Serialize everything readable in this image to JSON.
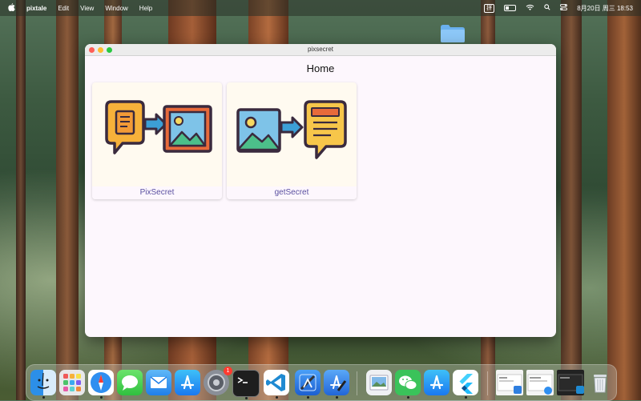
{
  "menubar": {
    "apple_icon": "apple-logo",
    "app_name": "pixtale",
    "menus": [
      "Edit",
      "View",
      "Window",
      "Help"
    ],
    "input_method": "拼",
    "datetime": "8月20日 周三  18:53"
  },
  "window": {
    "title": "pixsecret",
    "page_title": "Home",
    "cards": [
      {
        "label": "PixSecret",
        "icon": "text-to-image-icon"
      },
      {
        "label": "getSecret",
        "icon": "image-to-text-icon"
      }
    ]
  },
  "dock": {
    "apps": [
      {
        "name": "Finder",
        "icon": "finder-icon",
        "running": true
      },
      {
        "name": "Launchpad",
        "icon": "launchpad-icon",
        "running": false
      },
      {
        "name": "Safari",
        "icon": "safari-icon",
        "running": true
      },
      {
        "name": "Messages",
        "icon": "messages-icon",
        "running": false
      },
      {
        "name": "Mail",
        "icon": "mail-icon",
        "running": false
      },
      {
        "name": "App Store",
        "icon": "app-store-icon",
        "running": false
      },
      {
        "name": "System Settings",
        "icon": "system-settings-icon",
        "running": false,
        "badge": "1"
      },
      {
        "name": "Terminal",
        "icon": "terminal-icon",
        "running": true
      },
      {
        "name": "Visual Studio Code",
        "icon": "vscode-icon",
        "running": true
      },
      {
        "name": "Xcode",
        "icon": "xcode-icon",
        "running": true
      },
      {
        "name": "Instruments",
        "icon": "instruments-icon",
        "running": true
      },
      {
        "name": "Preview",
        "icon": "preview-icon",
        "running": false
      },
      {
        "name": "WeChat",
        "icon": "wechat-icon",
        "running": true
      },
      {
        "name": "App Store 2",
        "icon": "app-store-icon",
        "running": false
      },
      {
        "name": "Flutter",
        "icon": "flutter-icon",
        "running": true
      },
      {
        "name": "Window thumb 1",
        "icon": "window-thumbnail-icon",
        "running": false
      },
      {
        "name": "Window thumb 2",
        "icon": "window-thumbnail-icon",
        "running": false
      },
      {
        "name": "Window thumb 3",
        "icon": "window-thumbnail-icon",
        "running": false
      },
      {
        "name": "Trash",
        "icon": "trash-icon",
        "running": false
      }
    ]
  },
  "colors": {
    "window_bg": "#fdf7fd",
    "card_bg": "#fffaf0",
    "label_text": "#5a4fa0"
  }
}
